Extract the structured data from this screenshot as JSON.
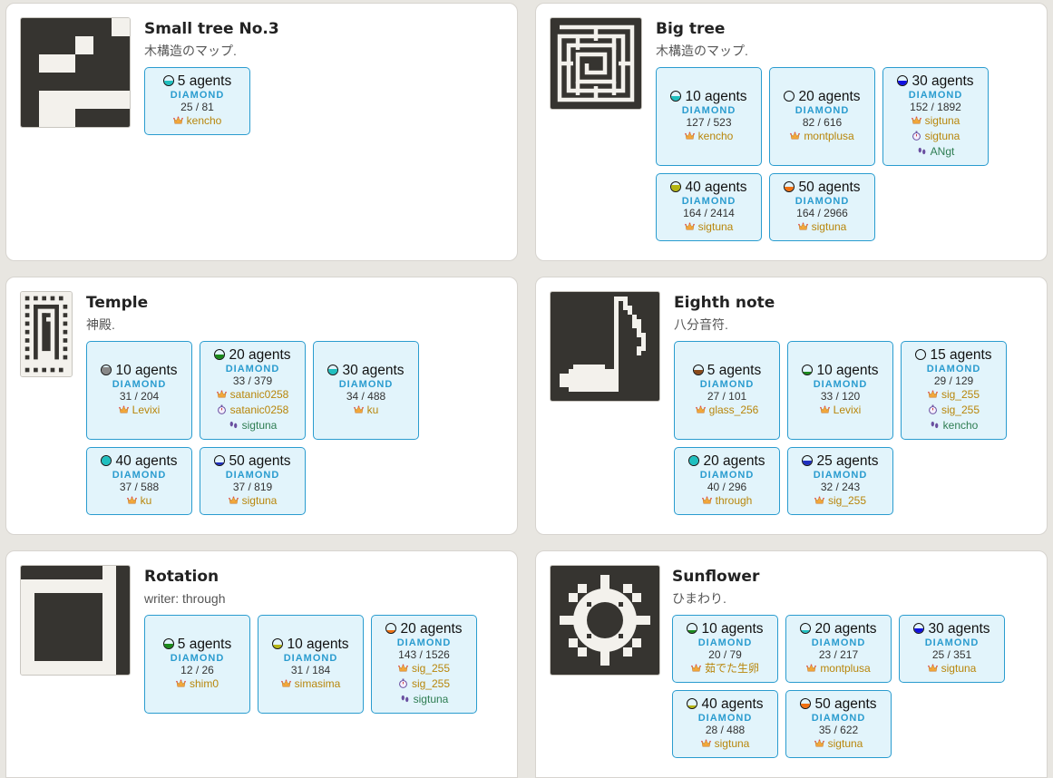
{
  "colors": {
    "box_bg": "#e2f4fb",
    "box_border": "#2a9ccf",
    "rank_color": "#2a9ccf",
    "crown_user": "#b8860b",
    "step_user": "#2e7d52"
  },
  "maps": [
    {
      "title": "Small tree No.3",
      "subtitle": "木構造のマップ.",
      "thumbnail_icon": "small-tree-map-thumbnail",
      "records": [
        {
          "agents": "5 agents",
          "dot_color": "#1fbfbf",
          "dot_fill": 0.5,
          "rank": "DIAMOND",
          "score": "25 / 81",
          "holders": [
            {
              "icon": "crown-icon",
              "name": "kencho"
            }
          ]
        }
      ]
    },
    {
      "title": "Big tree",
      "subtitle": "木構造のマップ.",
      "thumbnail_icon": "big-tree-maze-thumbnail",
      "records": [
        {
          "agents": "10 agents",
          "dot_color": "#1fbfbf",
          "dot_fill": 0.5,
          "rank": "DIAMOND",
          "score": "127 / 523",
          "holders": [
            {
              "icon": "crown-icon",
              "name": "kencho"
            }
          ]
        },
        {
          "agents": "20 agents",
          "dot_color": "#1f2fbf",
          "dot_fill": 0,
          "rank": "DIAMOND",
          "score": "82 / 616",
          "holders": [
            {
              "icon": "crown-icon",
              "name": "montplusa"
            }
          ]
        },
        {
          "agents": "30 agents",
          "dot_color": "#1010e0",
          "dot_fill": 0.5,
          "rank": "DIAMOND",
          "score": "152 / 1892",
          "holders": [
            {
              "icon": "crown-icon",
              "name": "sigtuna"
            },
            {
              "icon": "stopwatch-icon",
              "name": "sigtuna"
            },
            {
              "icon": "footprints-icon",
              "name": "ANgt"
            }
          ]
        },
        {
          "agents": "40 agents",
          "dot_color": "#b5b512",
          "dot_fill": 0.7,
          "rank": "DIAMOND",
          "score": "164 / 2414",
          "holders": [
            {
              "icon": "crown-icon",
              "name": "sigtuna"
            }
          ]
        },
        {
          "agents": "50 agents",
          "dot_color": "#f07010",
          "dot_fill": 0.5,
          "rank": "DIAMOND",
          "score": "164 / 2966",
          "holders": [
            {
              "icon": "crown-icon",
              "name": "sigtuna"
            }
          ]
        }
      ]
    },
    {
      "title": "Temple",
      "subtitle": "神殿.",
      "thumbnail_icon": "temple-map-thumbnail",
      "records": [
        {
          "agents": "10 agents",
          "dot_color": "#888888",
          "dot_fill": 0.8,
          "rank": "DIAMOND",
          "score": "31 / 204",
          "holders": [
            {
              "icon": "crown-icon",
              "name": "Levixi"
            }
          ]
        },
        {
          "agents": "20 agents",
          "dot_color": "#1a8a1a",
          "dot_fill": 0.5,
          "rank": "DIAMOND",
          "score": "33 / 379",
          "holders": [
            {
              "icon": "crown-icon",
              "name": "satanic0258"
            },
            {
              "icon": "stopwatch-icon",
              "name": "satanic0258"
            },
            {
              "icon": "footprints-icon",
              "name": "sigtuna"
            }
          ]
        },
        {
          "agents": "30 agents",
          "dot_color": "#1fbfbf",
          "dot_fill": 0.6,
          "rank": "DIAMOND",
          "score": "34 / 488",
          "holders": [
            {
              "icon": "crown-icon",
              "name": "ku"
            }
          ]
        },
        {
          "agents": "40 agents",
          "dot_color": "#1fbfbf",
          "dot_fill": 1,
          "rank": "DIAMOND",
          "score": "37 / 588",
          "holders": [
            {
              "icon": "crown-icon",
              "name": "ku"
            }
          ]
        },
        {
          "agents": "50 agents",
          "dot_color": "#1f2fbf",
          "dot_fill": 0.3,
          "rank": "DIAMOND",
          "score": "37 / 819",
          "holders": [
            {
              "icon": "crown-icon",
              "name": "sigtuna"
            }
          ]
        }
      ]
    },
    {
      "title": "Eighth note",
      "subtitle": "八分音符.",
      "thumbnail_icon": "eighth-note-map-thumbnail",
      "records": [
        {
          "agents": "5 agents",
          "dot_color": "#8a4a1a",
          "dot_fill": 0.5,
          "rank": "DIAMOND",
          "score": "27 / 101",
          "holders": [
            {
              "icon": "crown-icon",
              "name": "glass_256"
            }
          ]
        },
        {
          "agents": "10 agents",
          "dot_color": "#1a8a1a",
          "dot_fill": 0.3,
          "rank": "DIAMOND",
          "score": "33 / 120",
          "holders": [
            {
              "icon": "crown-icon",
              "name": "Levixi"
            }
          ]
        },
        {
          "agents": "15 agents",
          "dot_color": "#1fbfbf",
          "dot_fill": 0,
          "rank": "DIAMOND",
          "score": "29 / 129",
          "holders": [
            {
              "icon": "crown-icon",
              "name": "sig_255"
            },
            {
              "icon": "stopwatch-icon",
              "name": "sig_255"
            },
            {
              "icon": "footprints-icon",
              "name": "kencho"
            }
          ]
        },
        {
          "agents": "20 agents",
          "dot_color": "#1fbfbf",
          "dot_fill": 1,
          "rank": "DIAMOND",
          "score": "40 / 296",
          "holders": [
            {
              "icon": "crown-icon",
              "name": "through"
            }
          ]
        },
        {
          "agents": "25 agents",
          "dot_color": "#1f2fbf",
          "dot_fill": 0.5,
          "rank": "DIAMOND",
          "score": "32 / 243",
          "holders": [
            {
              "icon": "crown-icon",
              "name": "sig_255"
            }
          ]
        }
      ]
    },
    {
      "title": "Rotation",
      "subtitle": "writer: through",
      "thumbnail_icon": "rotation-map-thumbnail",
      "records": [
        {
          "agents": "5 agents",
          "dot_color": "#1a8a1a",
          "dot_fill": 0.5,
          "rank": "DIAMOND",
          "score": "12 / 26",
          "holders": [
            {
              "icon": "crown-icon",
              "name": "shim0"
            }
          ]
        },
        {
          "agents": "10 agents",
          "dot_color": "#b5b512",
          "dot_fill": 0.4,
          "rank": "DIAMOND",
          "score": "31 / 184",
          "holders": [
            {
              "icon": "crown-icon",
              "name": "simasima"
            }
          ]
        },
        {
          "agents": "20 agents",
          "dot_color": "#f07010",
          "dot_fill": 0.3,
          "rank": "DIAMOND",
          "score": "143 / 1526",
          "holders": [
            {
              "icon": "crown-icon",
              "name": "sig_255"
            },
            {
              "icon": "stopwatch-icon",
              "name": "sig_255"
            },
            {
              "icon": "footprints-icon",
              "name": "sigtuna"
            }
          ]
        }
      ]
    },
    {
      "title": "Sunflower",
      "subtitle": "ひまわり.",
      "thumbnail_icon": "sunflower-map-thumbnail",
      "records": [
        {
          "agents": "10 agents",
          "dot_color": "#1a8a1a",
          "dot_fill": 0.3,
          "rank": "DIAMOND",
          "score": "20 / 79",
          "holders": [
            {
              "icon": "crown-icon",
              "name": "茹でた生卵"
            }
          ]
        },
        {
          "agents": "20 agents",
          "dot_color": "#1fbfbf",
          "dot_fill": 0.3,
          "rank": "DIAMOND",
          "score": "23 / 217",
          "holders": [
            {
              "icon": "crown-icon",
              "name": "montplusa"
            }
          ]
        },
        {
          "agents": "30 agents",
          "dot_color": "#1010e0",
          "dot_fill": 0.5,
          "rank": "DIAMOND",
          "score": "25 / 351",
          "holders": [
            {
              "icon": "crown-icon",
              "name": "sigtuna"
            }
          ]
        },
        {
          "agents": "40 agents",
          "dot_color": "#b5b512",
          "dot_fill": 0.3,
          "rank": "DIAMOND",
          "score": "28 / 488",
          "holders": [
            {
              "icon": "crown-icon",
              "name": "sigtuna"
            }
          ]
        },
        {
          "agents": "50 agents",
          "dot_color": "#f07010",
          "dot_fill": 0.5,
          "rank": "DIAMOND",
          "score": "35 / 622",
          "holders": [
            {
              "icon": "crown-icon",
              "name": "sigtuna"
            }
          ]
        }
      ]
    }
  ]
}
